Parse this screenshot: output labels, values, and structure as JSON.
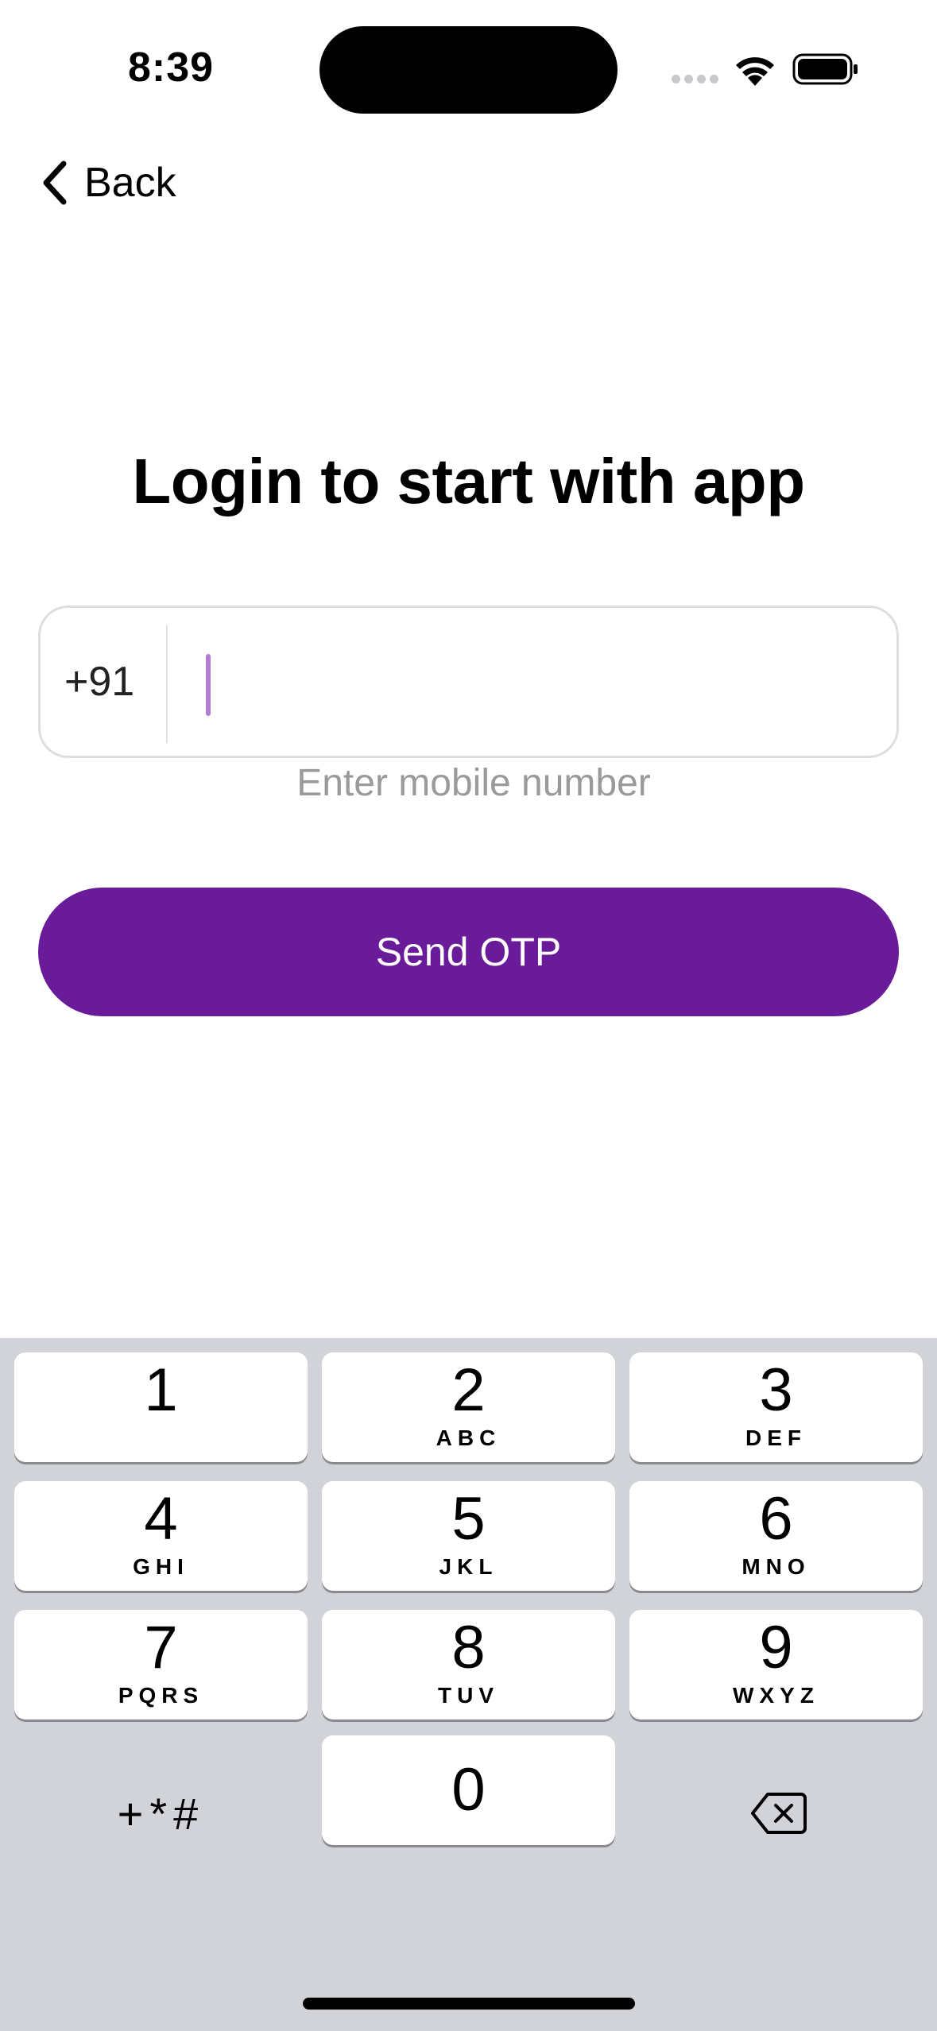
{
  "status_bar": {
    "time": "8:39",
    "icons": [
      "cellular-signal-icon",
      "wifi-icon",
      "battery-icon"
    ]
  },
  "nav": {
    "back_label": "Back",
    "back_icon": "chevron-left-icon"
  },
  "login": {
    "title": "Login to start with app",
    "country_code": "+91",
    "phone_value": "",
    "phone_placeholder": "",
    "hint": "Enter mobile number",
    "send_button_label": "Send OTP"
  },
  "colors": {
    "accent": "#6a1b9a",
    "caret": "#b07cd6",
    "keyboard_bg": "#d1d3d9",
    "hint_text": "#9a9a9a"
  },
  "keypad": {
    "keys": [
      {
        "digit": "1",
        "letters": ""
      },
      {
        "digit": "2",
        "letters": "ABC"
      },
      {
        "digit": "3",
        "letters": "DEF"
      },
      {
        "digit": "4",
        "letters": "GHI"
      },
      {
        "digit": "5",
        "letters": "JKL"
      },
      {
        "digit": "6",
        "letters": "MNO"
      },
      {
        "digit": "7",
        "letters": "PQRS"
      },
      {
        "digit": "8",
        "letters": "TUV"
      },
      {
        "digit": "9",
        "letters": "WXYZ"
      },
      {
        "digit": "0",
        "letters": ""
      }
    ],
    "symbols_label": "+*#",
    "delete_icon": "backspace-icon"
  }
}
